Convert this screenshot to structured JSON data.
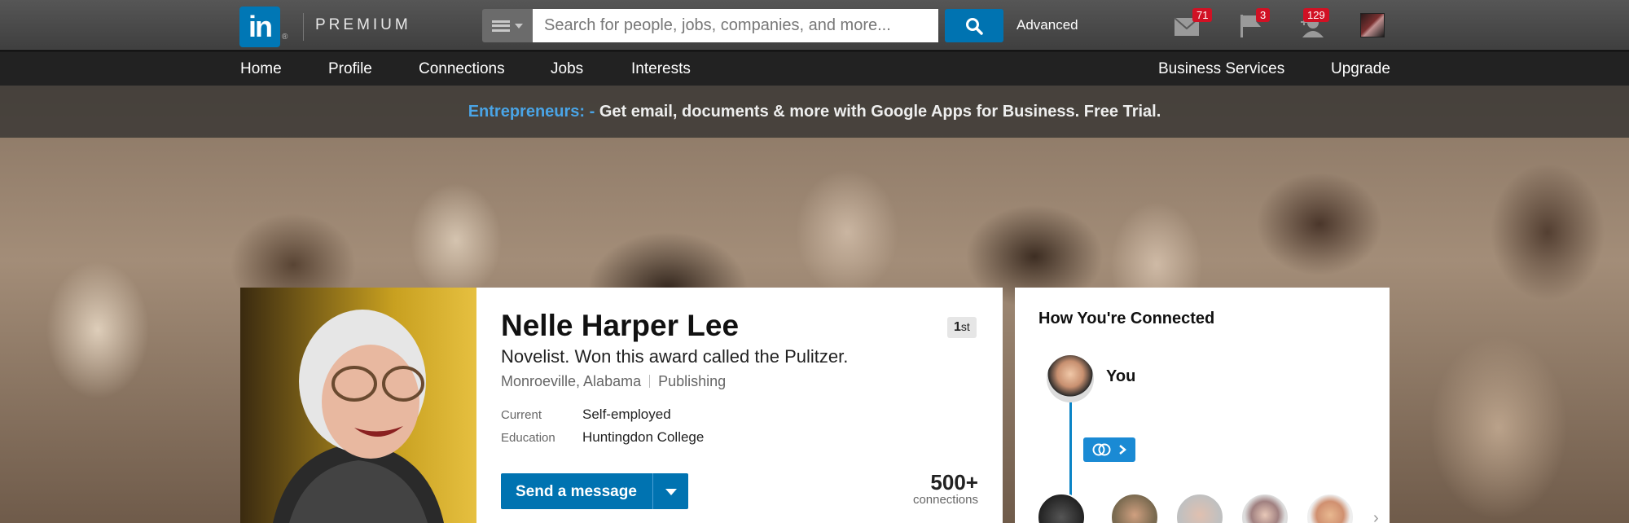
{
  "topbar": {
    "logo_text": "in",
    "logo_mark": "®",
    "premium": "PREMIUM",
    "search_placeholder": "Search for people, jobs, companies, and more...",
    "advanced": "Advanced",
    "icons": [
      "menu-icon",
      "search-icon",
      "envelope-icon",
      "flag-icon",
      "add-connection-icon"
    ],
    "badges": {
      "messages": "71",
      "notifications": "3",
      "invitations": "129"
    }
  },
  "nav": {
    "items": [
      "Home",
      "Profile",
      "Connections",
      "Jobs",
      "Interests"
    ],
    "right_items": [
      "Business Services",
      "Upgrade"
    ]
  },
  "promo": {
    "highlight": "Entrepreneurs: -",
    "text": " Get email, documents & more with Google Apps for Business. Free Trial."
  },
  "profile": {
    "name": "Nelle Harper Lee",
    "degree_num": "1",
    "degree_suffix": "st",
    "headline": "Novelist. Won this award called the Pulitzer.",
    "location": "Monroeville, Alabama",
    "industry": "Publishing",
    "current_label": "Current",
    "current_value": "Self-employed",
    "education_label": "Education",
    "education_value": "Huntingdon College",
    "send_message": "Send a message",
    "connections_count": "500+",
    "connections_label": "connections"
  },
  "connected": {
    "title": "How You're Connected",
    "you_label": "You",
    "next_icon": "chevron-right-icon"
  },
  "colors": {
    "brand": "#0077b5",
    "button": "#0073b1",
    "badge": "#d11124",
    "promo_highlight": "#4aa4e6"
  }
}
